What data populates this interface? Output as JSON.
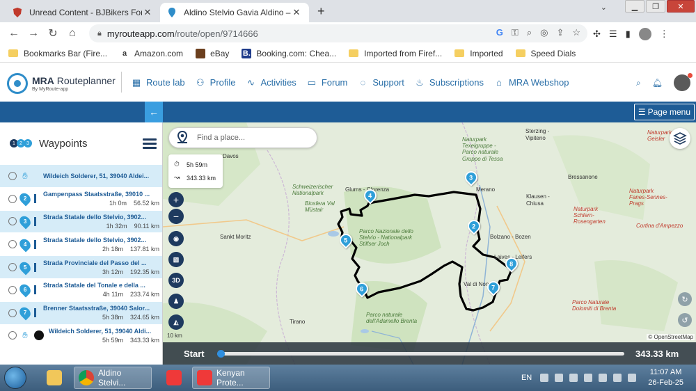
{
  "browser": {
    "tabs": [
      {
        "title": "Unread Content - BJBikers Forum",
        "active": false
      },
      {
        "title": "Aldino Stelvio Gavia Aldino – MyR",
        "active": true
      }
    ],
    "url_domain": "myrouteapp.com",
    "url_path": "/route/open/9714666",
    "bookmarks": [
      {
        "label": "Bookmarks Bar (Fire...",
        "icon": "folder-icon"
      },
      {
        "label": "Amazon.com",
        "icon": "amazon-icon"
      },
      {
        "label": "eBay",
        "icon": "ebay-icon"
      },
      {
        "label": "Booking.com: Chea...",
        "icon": "booking-icon"
      },
      {
        "label": "Imported from Firef...",
        "icon": "folder-icon"
      },
      {
        "label": "Imported",
        "icon": "folder-icon"
      },
      {
        "label": "Speed Dials",
        "icon": "folder-icon"
      }
    ]
  },
  "app": {
    "logo_name_bold": "MRA",
    "logo_name_rest": "Routeplanner",
    "logo_tagline": "By MyRoute-app",
    "nav": [
      {
        "label": "Route lab",
        "icon": "route-lab-icon"
      },
      {
        "label": "Profile",
        "icon": "profile-icon"
      },
      {
        "label": "Activities",
        "icon": "activities-icon"
      },
      {
        "label": "Forum",
        "icon": "forum-icon"
      },
      {
        "label": "Support",
        "icon": "support-icon"
      },
      {
        "label": "Subscriptions",
        "icon": "subscriptions-icon"
      },
      {
        "label": "MRA Webshop",
        "icon": "webshop-icon"
      }
    ],
    "page_menu_label": "Page menu"
  },
  "sidebar": {
    "title": "Waypoints",
    "waypoints": [
      {
        "marker": "",
        "name": "Wildeich Solderer, 51, 39040 Aldei...",
        "time": "",
        "distance": "",
        "highlight": true
      },
      {
        "marker": "2",
        "name": "Gampenpass Staatsstraße, 39010 ...",
        "time": "1h 0m",
        "distance": "56.52 km",
        "highlight": false
      },
      {
        "marker": "3",
        "name": "Strada Statale dello Stelvio, 3902...",
        "time": "1h 32m",
        "distance": "90.11 km",
        "highlight": true
      },
      {
        "marker": "4",
        "name": "Strada Statale dello Stelvio, 3902...",
        "time": "2h 18m",
        "distance": "137.81 km",
        "highlight": false
      },
      {
        "marker": "5",
        "name": "Strada Provinciale del Passo del ...",
        "time": "3h 12m",
        "distance": "192.35 km",
        "highlight": true
      },
      {
        "marker": "6",
        "name": "Strada Statale del Tonale e della ...",
        "time": "4h 11m",
        "distance": "233.74 km",
        "highlight": false
      },
      {
        "marker": "7",
        "name": "Brenner Staatsstraße, 39040 Salor...",
        "time": "5h 38m",
        "distance": "324.65 km",
        "highlight": true
      },
      {
        "marker": "",
        "name": "Wildeich Solderer, 51, 39040 Aldi...",
        "time": "5h 59m",
        "distance": "343.33 km",
        "highlight": false
      }
    ]
  },
  "map": {
    "search_placeholder": "Find a place...",
    "total_time": "5h 59m",
    "total_distance": "343.33 km",
    "tool_3d_label": "3D",
    "attribution": "© OpenStreetMap",
    "scale_label": "10 km",
    "labels": {
      "sterzing": "Sterzing -",
      "vipiteno": "Vipiteno",
      "davos": "Davos",
      "glurns": "Glurns - Glorenza",
      "merano": "Merano",
      "bressanone": "Bressanone",
      "klausen": "Klausen -",
      "chiusa": "Chiusa",
      "bolzano": "Bolzano - Bozen",
      "leifers": "Laives - Leifers",
      "sankt_moritz": "Sankt Moritz",
      "cortina": "Cortina d'Ampezzo",
      "tirano": "Tirano",
      "stelvio_park": "Parco Nazionale dello Stelvio - Nationalpark Stilfser Joch",
      "adamello_park": "Parco naturale dell'Adamello Brenta",
      "texelgruppe": "Naturpark Texelgruppe - Parco naturale Gruppo di Tessa",
      "schweizerischer": "Schweizerischer Nationalpark",
      "biosfera": "Biosfera Val Müstair",
      "puez": "Naturpark Puez-Geisler",
      "fanes": "Naturpark Fanes-Sennes-Prags",
      "sciliar": "Naturpark Schlern-Rosengarten",
      "dolomiti": "Parco Naturale Dolomiti di Brenta",
      "val_di_non": "Val di Non"
    },
    "markers": [
      "2",
      "3",
      "4",
      "5",
      "6",
      "7",
      "8"
    ]
  },
  "progress": {
    "start_label": "Start",
    "distance_label": "343.33 km",
    "position_fraction": 0
  },
  "taskbar": {
    "items": [
      {
        "label": "",
        "icon": "explorer-icon"
      },
      {
        "label": "Aldino Stelvi...",
        "icon": "chrome-icon"
      },
      {
        "label": "",
        "icon": "vivaldi-icon"
      },
      {
        "label": "Kenyan Prote...",
        "icon": "vivaldi-icon"
      }
    ],
    "language": "EN",
    "time": "11:07 AM",
    "date": "26-Feb-25"
  },
  "colors": {
    "accent": "#1e5c96",
    "marker": "#2f9fd9",
    "nav_text": "#2a6fa8"
  }
}
